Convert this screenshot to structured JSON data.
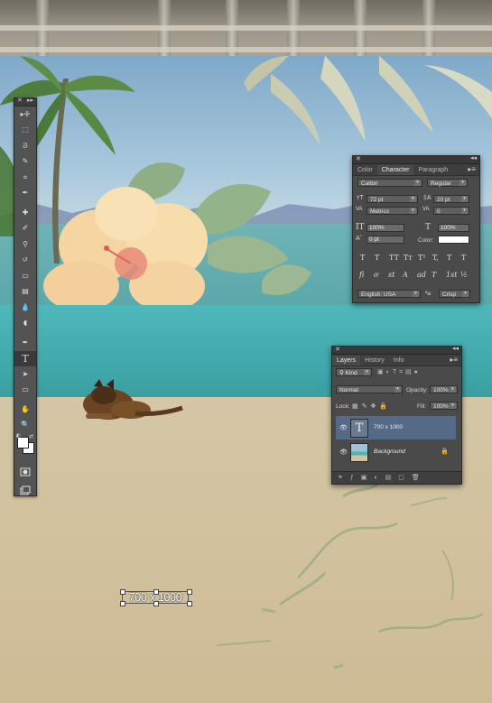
{
  "app": {
    "tools": [
      {
        "icon": "move-icon",
        "glyph": "▸✢"
      },
      {
        "icon": "marquee-icon",
        "glyph": "⬚"
      },
      {
        "icon": "lasso-icon",
        "glyph": "ᘐ"
      },
      {
        "icon": "quick-select-icon",
        "glyph": "✎"
      },
      {
        "icon": "crop-icon",
        "glyph": "⌗"
      },
      {
        "icon": "eyedropper-icon",
        "glyph": "✒"
      },
      {
        "icon": "healing-brush-icon",
        "glyph": "✚"
      },
      {
        "icon": "brush-icon",
        "glyph": "✐"
      },
      {
        "icon": "clone-stamp-icon",
        "glyph": "⚲"
      },
      {
        "icon": "history-brush-icon",
        "glyph": "↺"
      },
      {
        "icon": "eraser-icon",
        "glyph": "▭"
      },
      {
        "icon": "gradient-icon",
        "glyph": "▤"
      },
      {
        "icon": "blur-icon",
        "glyph": "💧"
      },
      {
        "icon": "dodge-icon",
        "glyph": "◖"
      },
      {
        "icon": "pen-icon",
        "glyph": "✒"
      },
      {
        "icon": "type-tool-icon",
        "glyph": "T"
      },
      {
        "icon": "path-select-icon",
        "glyph": "➤"
      },
      {
        "icon": "rectangle-icon",
        "glyph": "▭"
      },
      {
        "icon": "hand-icon",
        "glyph": "✋"
      },
      {
        "icon": "zoom-icon",
        "glyph": "🔍"
      }
    ],
    "active_tool": "type-tool-icon"
  },
  "character_panel": {
    "tabs": [
      "Color",
      "Character",
      "Paragraph"
    ],
    "active_tab": "Character",
    "font_family": "Calibri",
    "font_style": "Regular",
    "font_size": "72 pt",
    "leading": "20 pt",
    "kerning": "Metrics",
    "tracking": "0",
    "vertical_scale": "100%",
    "horizontal_scale": "100%",
    "baseline_shift": "0 pt",
    "color_label": "Color:",
    "color_value": "#ffffff",
    "style_buttons": [
      "T",
      "T",
      "TT",
      "Tт",
      "T¹",
      "T,",
      "T",
      "T"
    ],
    "opentype_buttons": [
      "fi",
      "ơ",
      "st",
      "A",
      "ad",
      "T",
      "1st",
      "½"
    ],
    "language": "English: USA",
    "aa_label": "ªa",
    "antialias": "Crisp"
  },
  "layers_panel": {
    "tabs": [
      "Layers",
      "History",
      "Info"
    ],
    "active_tab": "Layers",
    "filter_kind": "Kind",
    "blend_mode": "Normal",
    "opacity_label": "Opacity:",
    "opacity": "100%",
    "lock_label": "Lock:",
    "fill_label": "Fill:",
    "fill": "100%",
    "layers": [
      {
        "name": "700 x 1000",
        "type": "text",
        "selected": true
      },
      {
        "name": "Background",
        "type": "image",
        "locked": true
      }
    ]
  },
  "canvas_text": "700 x 1000",
  "colors": {
    "panel_bg": "#4a4a4a",
    "panel_header": "#383838",
    "selected_layer": "#546a86",
    "wall_teal": "#45b0b3",
    "floor_sand": "#d2c29e"
  }
}
